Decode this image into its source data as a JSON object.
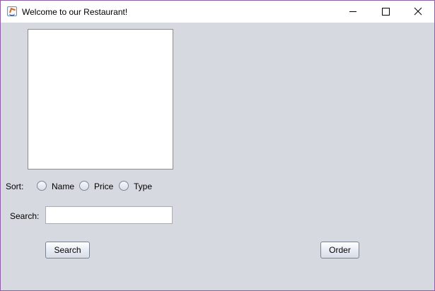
{
  "window": {
    "title": "Welcome to our Restaurant!",
    "controls": {
      "minimize": "minimize-icon",
      "maximize": "maximize-icon",
      "close": "close-icon"
    }
  },
  "sort": {
    "label": "Sort:",
    "options": [
      {
        "label": "Name",
        "selected": false
      },
      {
        "label": "Price",
        "selected": false
      },
      {
        "label": "Type",
        "selected": false
      }
    ]
  },
  "search": {
    "label": "Search:",
    "value": "",
    "button_label": "Search"
  },
  "order": {
    "button_label": "Order"
  },
  "colors": {
    "window_border": "#8e5fa5",
    "content_background": "#d6d9e0",
    "titlebar_background": "#ffffff",
    "list_background": "#ffffff"
  }
}
